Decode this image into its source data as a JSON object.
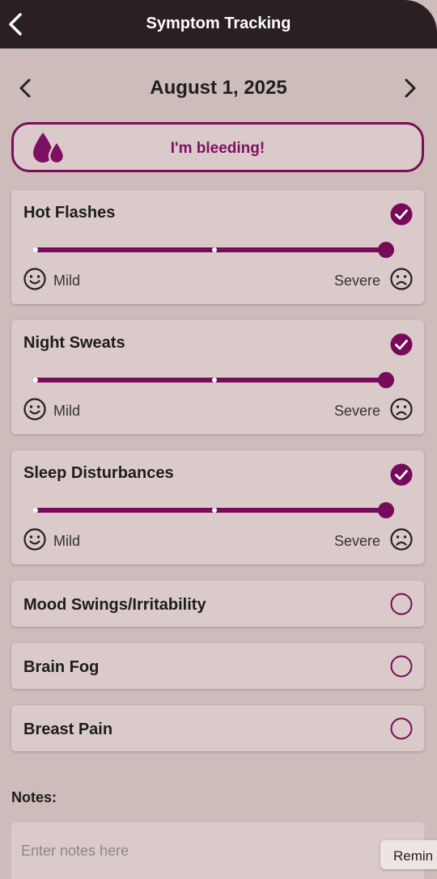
{
  "header": {
    "title": "Symptom Tracking",
    "back_icon": "chevron-left-icon"
  },
  "date_nav": {
    "date": "August 1, 2025",
    "prev_icon": "chevron-left-icon",
    "next_icon": "chevron-right-icon"
  },
  "bleeding_button": {
    "label": "I'm bleeding!",
    "icon": "blood-drops-icon"
  },
  "scale": {
    "mild_label": "Mild",
    "severe_label": "Severe"
  },
  "symptoms": [
    {
      "name": "Hot Flashes",
      "checked": true,
      "severity": 1.0
    },
    {
      "name": "Night Sweats",
      "checked": true,
      "severity": 1.0
    },
    {
      "name": "Sleep Disturbances",
      "checked": true,
      "severity": 1.0
    },
    {
      "name": "Mood Swings/Irritability",
      "checked": false
    },
    {
      "name": "Brain Fog",
      "checked": false
    },
    {
      "name": "Breast Pain",
      "checked": false
    }
  ],
  "notes": {
    "label": "Notes:",
    "placeholder": "Enter notes here",
    "value": ""
  },
  "reminder_button": {
    "label": "Remin"
  },
  "colors": {
    "accent": "#780a5b",
    "background": "#cdbcba",
    "card": "#dacbca",
    "header": "#2a2024"
  }
}
